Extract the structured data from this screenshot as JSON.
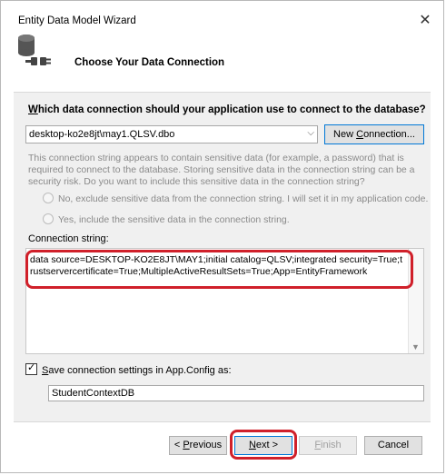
{
  "window": {
    "title": "Entity Data Model Wizard",
    "close_glyph": "✕"
  },
  "header": {
    "title": "Choose Your Data Connection",
    "icon": "database-plug-icon"
  },
  "question": {
    "text_before": "W",
    "text_after": "hich data connection should your application use to connect to the database?"
  },
  "connection_select": {
    "value": "desktop-ko2e8jt\\may1.QLSV.dbo",
    "arrow": "⌵"
  },
  "new_connection_button": {
    "label_before": "New ",
    "label_accel": "C",
    "label_after": "onnection..."
  },
  "warning": {
    "text": "This connection string appears to contain sensitive data (for example, a password) that is required to connect to the database. Storing sensitive data in the connection string can be a security risk. Do you want to include this sensitive data in the connection string?"
  },
  "radio_exclude": {
    "label": "No, exclude sensitive data from the connection string. I will set it in my application code."
  },
  "radio_include": {
    "label": "Yes, include the sensitive data in the connection string."
  },
  "connection_string": {
    "label": "Connection string:",
    "value": "data source=DESKTOP-KO2E8JT\\MAY1;initial catalog=QLSV;integrated security=True;trustservercertificate=True;MultipleActiveResultSets=True;App=EntityFramework"
  },
  "save_settings": {
    "checked": true,
    "label_accel": "S",
    "label_after": "ave connection settings in App.Config as:",
    "check_glyph": "✓"
  },
  "config_name": {
    "value": "StudentContextDB"
  },
  "buttons": {
    "previous_before": "< ",
    "previous_accel": "P",
    "previous_after": "revious",
    "next_accel": "N",
    "next_after": "ext >",
    "finish_accel": "F",
    "finish_after": "inish",
    "cancel": "Cancel"
  },
  "colors": {
    "highlight": "#d0202a",
    "accent": "#0078d7"
  }
}
